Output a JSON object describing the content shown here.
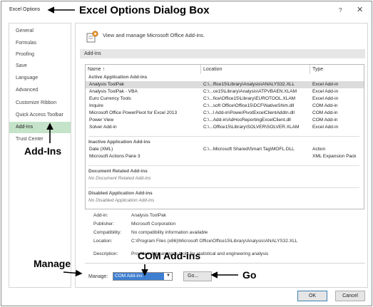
{
  "window": {
    "title": "Excel Options",
    "help_glyph": "?",
    "close_glyph": "✕"
  },
  "callouts": {
    "title": "Excel Options Dialog Box",
    "addins": "Add-Ins",
    "manage": "Manage",
    "com": "COM Add-ins",
    "go": "Go"
  },
  "sidebar": {
    "items": [
      {
        "label": "General"
      },
      {
        "label": "Formulas"
      },
      {
        "label": "Proofing"
      },
      {
        "label": "Save"
      },
      {
        "label": "Language"
      },
      {
        "label": "Advanced"
      },
      {
        "label": "Customize Ribbon"
      },
      {
        "label": "Quick Access Toolbar"
      },
      {
        "label": "Add-Ins",
        "active": true
      },
      {
        "label": "Trust Center"
      }
    ]
  },
  "main": {
    "header_text": "View and manage Microsoft Office Add-ins.",
    "section_title": "Add-ins",
    "columns": [
      "Name ↑",
      "Location",
      "Type"
    ],
    "groups": {
      "active": {
        "title": "Active Application Add-ins",
        "rows": [
          {
            "name": "Analysis ToolPak",
            "location": "C:\\...ffice15\\Library\\Analysis\\ANALYS32.XLL",
            "type": "Excel Add-in",
            "selected": true
          },
          {
            "name": "Analysis ToolPak - VBA",
            "location": "C:\\...ce15\\Library\\Analysis\\ATPVBAEN.XLAM",
            "type": "Excel Add-in"
          },
          {
            "name": "Euro Currency Tools",
            "location": "C:\\...fice\\Office15\\Library\\EUROTOOL.XLAM",
            "type": "Excel Add-in"
          },
          {
            "name": "Inquire",
            "location": "C:\\...soft Office\\Office15\\DCF\\NativeShim.dll",
            "type": "COM Add-in"
          },
          {
            "name": "Microsoft Office PowerPivot for Excel 2013",
            "location": "C:\\...l Add-in\\PowerPivotExcelClientAddIn.dll",
            "type": "COM Add-in"
          },
          {
            "name": "Power View",
            "location": "C:\\...Add-in\\AdHocReportingExcelClient.dll",
            "type": "COM Add-in"
          },
          {
            "name": "Solver Add-in",
            "location": "C:\\...Office15\\Library\\SOLVER\\SOLVER.XLAM",
            "type": "Excel Add-in"
          }
        ]
      },
      "inactive": {
        "title": "Inactive Application Add-ins",
        "rows": [
          {
            "name": "Date (XML)",
            "location": "C:\\...Microsoft Shared\\Smart Tag\\MOFL.DLL",
            "type": "Action"
          },
          {
            "name": "Microsoft Actions Pane 3",
            "location": "",
            "type": "XML Expansion Pack"
          }
        ]
      },
      "document": {
        "title": "Document Related Add-ins",
        "empty_text": "No Document Related Add-ins"
      },
      "disabled": {
        "title": "Disabled Application Add-ins",
        "empty_text": "No Disabled Application Add-ins"
      }
    },
    "details": {
      "addin_label": "Add-in:",
      "addin_value": "Analysis ToolPak",
      "publisher_label": "Publisher:",
      "publisher_value": "Microsoft Corporation",
      "compat_label": "Compatibility:",
      "compat_value": "No compatibility information available",
      "location_label": "Location:",
      "location_value": "C:\\Program Files (x86)\\Microsoft Office\\Office15\\Library\\Analysis\\ANALYS32.XLL",
      "description_label": "Description:",
      "description_value": "Provides data analysis tools for statistical and engineering analysis"
    },
    "manage": {
      "label": "Manage:",
      "selected": "COM Add-ins",
      "go_label": "Go..."
    }
  },
  "buttons": {
    "ok": "OK",
    "cancel": "Cancel"
  },
  "colors": {
    "active_sidebar": "#c5e3c8",
    "select_highlight": "#3f7fd1"
  }
}
